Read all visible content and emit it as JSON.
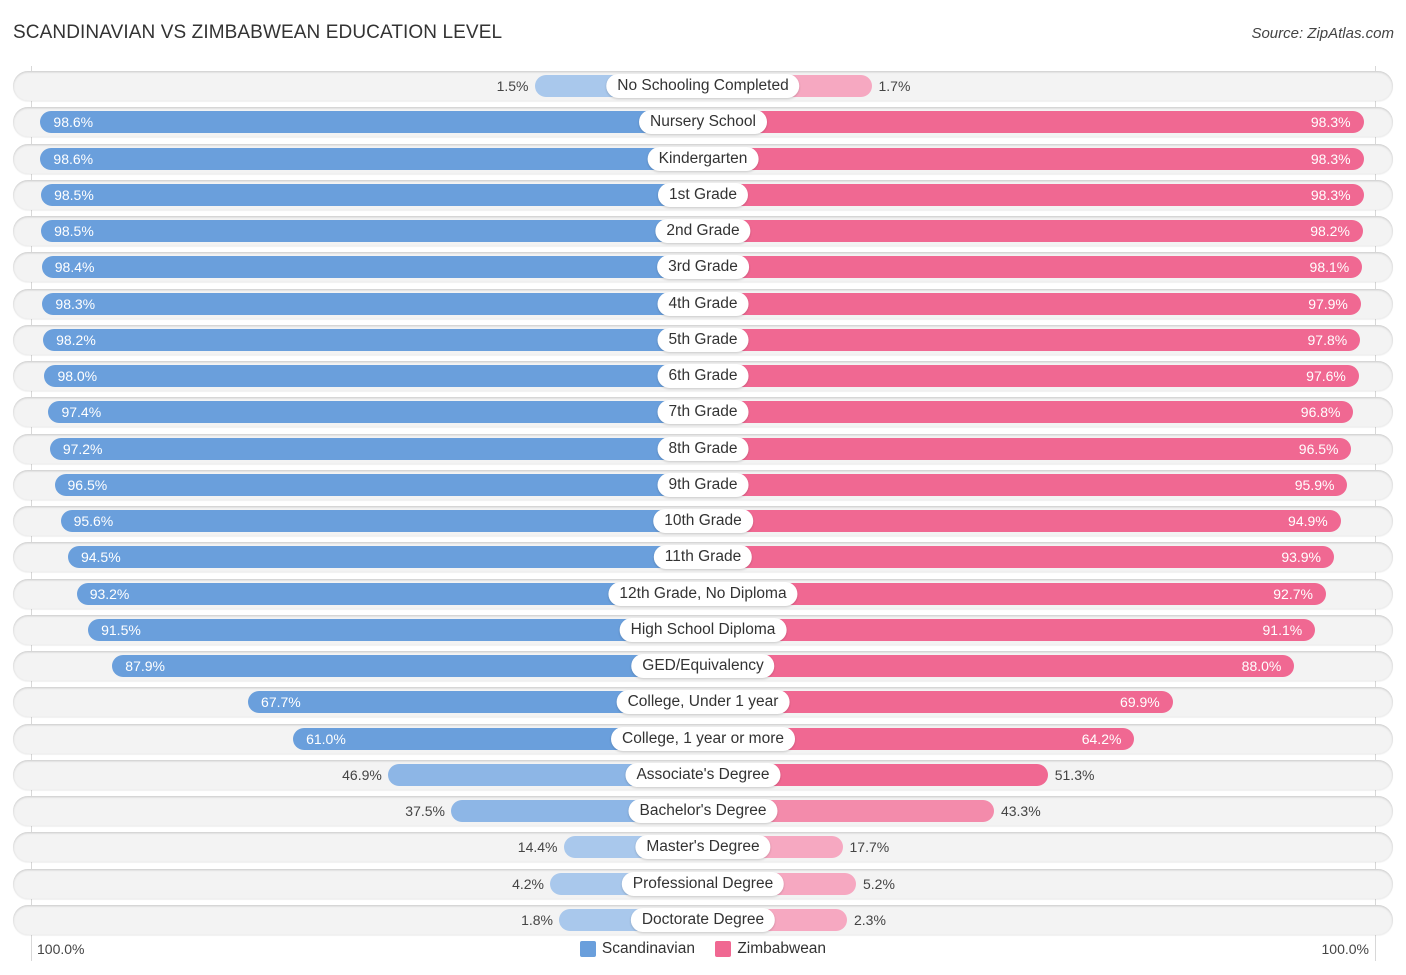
{
  "title": "SCANDINAVIAN VS ZIMBABWEAN EDUCATION LEVEL",
  "source": "Source: ZipAtlas.com",
  "colors": {
    "scandinavian": "#6a9fdc",
    "scandinavian_light": "#a9c8ec",
    "zimbabwean": "#f06892",
    "zimbabwean_light": "#f6a8c1"
  },
  "chart_data": {
    "type": "bar",
    "orientation": "horizontal-diverging",
    "title": "SCANDINAVIAN VS ZIMBABWEAN EDUCATION LEVEL",
    "xlabel": "",
    "ylabel": "",
    "xlim": [
      0,
      100
    ],
    "axis_labels": {
      "left": "100.0%",
      "right": "100.0%"
    },
    "legend_position": "bottom",
    "categories": [
      "No Schooling Completed",
      "Nursery School",
      "Kindergarten",
      "1st Grade",
      "2nd Grade",
      "3rd Grade",
      "4th Grade",
      "5th Grade",
      "6th Grade",
      "7th Grade",
      "8th Grade",
      "9th Grade",
      "10th Grade",
      "11th Grade",
      "12th Grade, No Diploma",
      "High School Diploma",
      "GED/Equivalency",
      "College, Under 1 year",
      "College, 1 year or more",
      "Associate's Degree",
      "Bachelor's Degree",
      "Master's Degree",
      "Professional Degree",
      "Doctorate Degree"
    ],
    "series": [
      {
        "name": "Scandinavian",
        "side": "left",
        "values": [
          1.5,
          98.6,
          98.6,
          98.5,
          98.5,
          98.4,
          98.3,
          98.2,
          98.0,
          97.4,
          97.2,
          96.5,
          95.6,
          94.5,
          93.2,
          91.5,
          87.9,
          67.7,
          61.0,
          46.9,
          37.5,
          14.4,
          4.2,
          1.8
        ],
        "labels": [
          "1.5%",
          "98.6%",
          "98.6%",
          "98.5%",
          "98.5%",
          "98.4%",
          "98.3%",
          "98.2%",
          "98.0%",
          "97.4%",
          "97.2%",
          "96.5%",
          "95.6%",
          "94.5%",
          "93.2%",
          "91.5%",
          "87.9%",
          "67.7%",
          "61.0%",
          "46.9%",
          "37.5%",
          "14.4%",
          "4.2%",
          "1.8%"
        ]
      },
      {
        "name": "Zimbabwean",
        "side": "right",
        "values": [
          1.7,
          98.3,
          98.3,
          98.3,
          98.2,
          98.1,
          97.9,
          97.8,
          97.6,
          96.8,
          96.5,
          95.9,
          94.9,
          93.9,
          92.7,
          91.1,
          88.0,
          69.9,
          64.2,
          51.3,
          43.3,
          17.7,
          5.2,
          2.3
        ],
        "labels": [
          "1.7%",
          "98.3%",
          "98.3%",
          "98.3%",
          "98.2%",
          "98.1%",
          "97.9%",
          "97.8%",
          "97.6%",
          "96.8%",
          "96.5%",
          "95.9%",
          "94.9%",
          "93.9%",
          "92.7%",
          "91.1%",
          "88.0%",
          "69.9%",
          "64.2%",
          "51.3%",
          "43.3%",
          "17.7%",
          "5.2%",
          "2.3%"
        ]
      }
    ]
  },
  "legend": {
    "items": [
      {
        "label": "Scandinavian"
      },
      {
        "label": "Zimbabwean"
      }
    ]
  }
}
